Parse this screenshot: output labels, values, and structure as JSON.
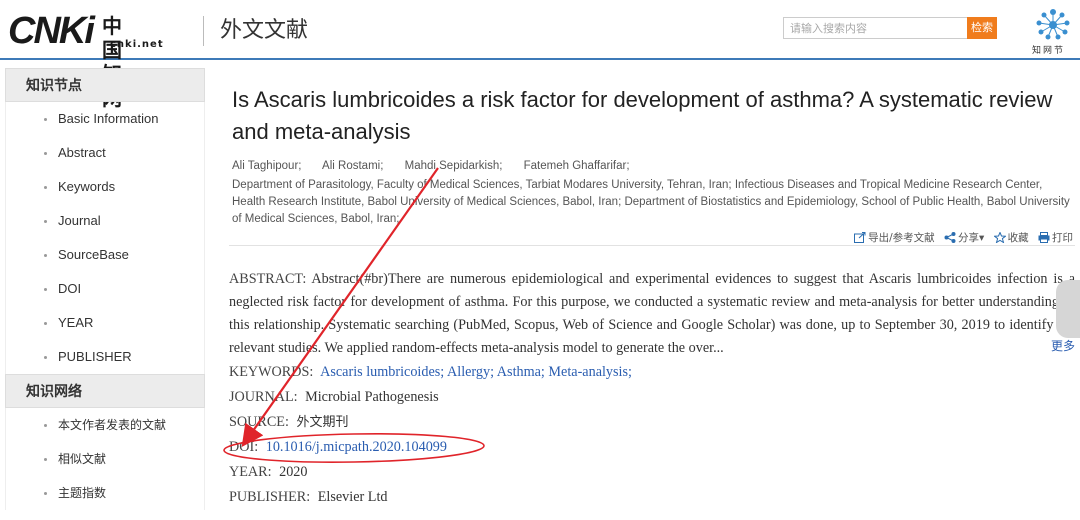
{
  "header": {
    "logo_mark": "CNKi",
    "logo_cn": "中国知网",
    "logo_net": "cnki.net",
    "site_title": "外文文献",
    "search_placeholder": "请输入搜索内容",
    "search_button": "检索",
    "brand_badge_text": "知网节"
  },
  "sidebar": {
    "section1_title": "知识节点",
    "section1_items": [
      "Basic Information",
      "Abstract",
      "Keywords",
      "Journal",
      "SourceBase",
      "DOI",
      "YEAR",
      "PUBLISHER"
    ],
    "section2_title": "知识网络",
    "section2_items": [
      "本文作者发表的文献",
      "相似文献",
      "主题指数"
    ]
  },
  "article": {
    "title": "Is Ascaris lumbricoides a risk factor for development of asthma? A systematic review and meta-analysis",
    "authors": [
      "Ali Taghipour;",
      "Ali Rostami;",
      "Mahdi Sepidarkish;",
      "Fatemeh Ghaffarifar;"
    ],
    "affiliations": "Department of Parasitology, Faculty of Medical Sciences, Tarbiat Modares University, Tehran, Iran;      Infectious Diseases and Tropical Medicine Research Center, Health Research Institute, Babol University of Medical Sciences, Babol, Iran;      Department of Biostatistics and Epidemiology, School of Public Health, Babol University of Medical Sciences, Babol, Iran;",
    "tools": {
      "export": "导出/参考文献",
      "share": "分享▾",
      "favorite": "收藏",
      "print": "打印"
    },
    "abstract_label": "ABSTRACT:",
    "abstract_text": "Abstract(#br)There are numerous epidemiological and experimental evidences to suggest that Ascaris lumbricoides infection is a neglected risk factor for development of asthma. For this purpose, we conducted a systematic review and meta-analysis for better understanding of this relationship. Systematic searching (PubMed, Scopus, Web of Science and Google Scholar) was done, up to September 30, 2019 to identify the relevant studies. We applied random-effects meta-analysis model to generate the over...",
    "more_link": "更多",
    "keywords_label": "KEYWORDS:",
    "keywords": [
      "Ascaris lumbricoides;",
      "Allergy;",
      "Asthma;",
      "Meta-analysis;"
    ],
    "journal_label": "JOURNAL:",
    "journal_value": "Microbial Pathogenesis",
    "source_label": "SOURCE:",
    "source_value": "外文期刊",
    "doi_label": "DOI:",
    "doi_value": "10.1016/j.micpath.2020.104099",
    "year_label": "YEAR:",
    "year_value": "2020",
    "publisher_label": "PUBLISHER:",
    "publisher_value": "Elsevier Ltd"
  },
  "colors": {
    "accent_blue": "#3d7ab8",
    "link_blue": "#2a5db0",
    "search_orange": "#f07c1c",
    "annotation_red": "#e0242a"
  }
}
